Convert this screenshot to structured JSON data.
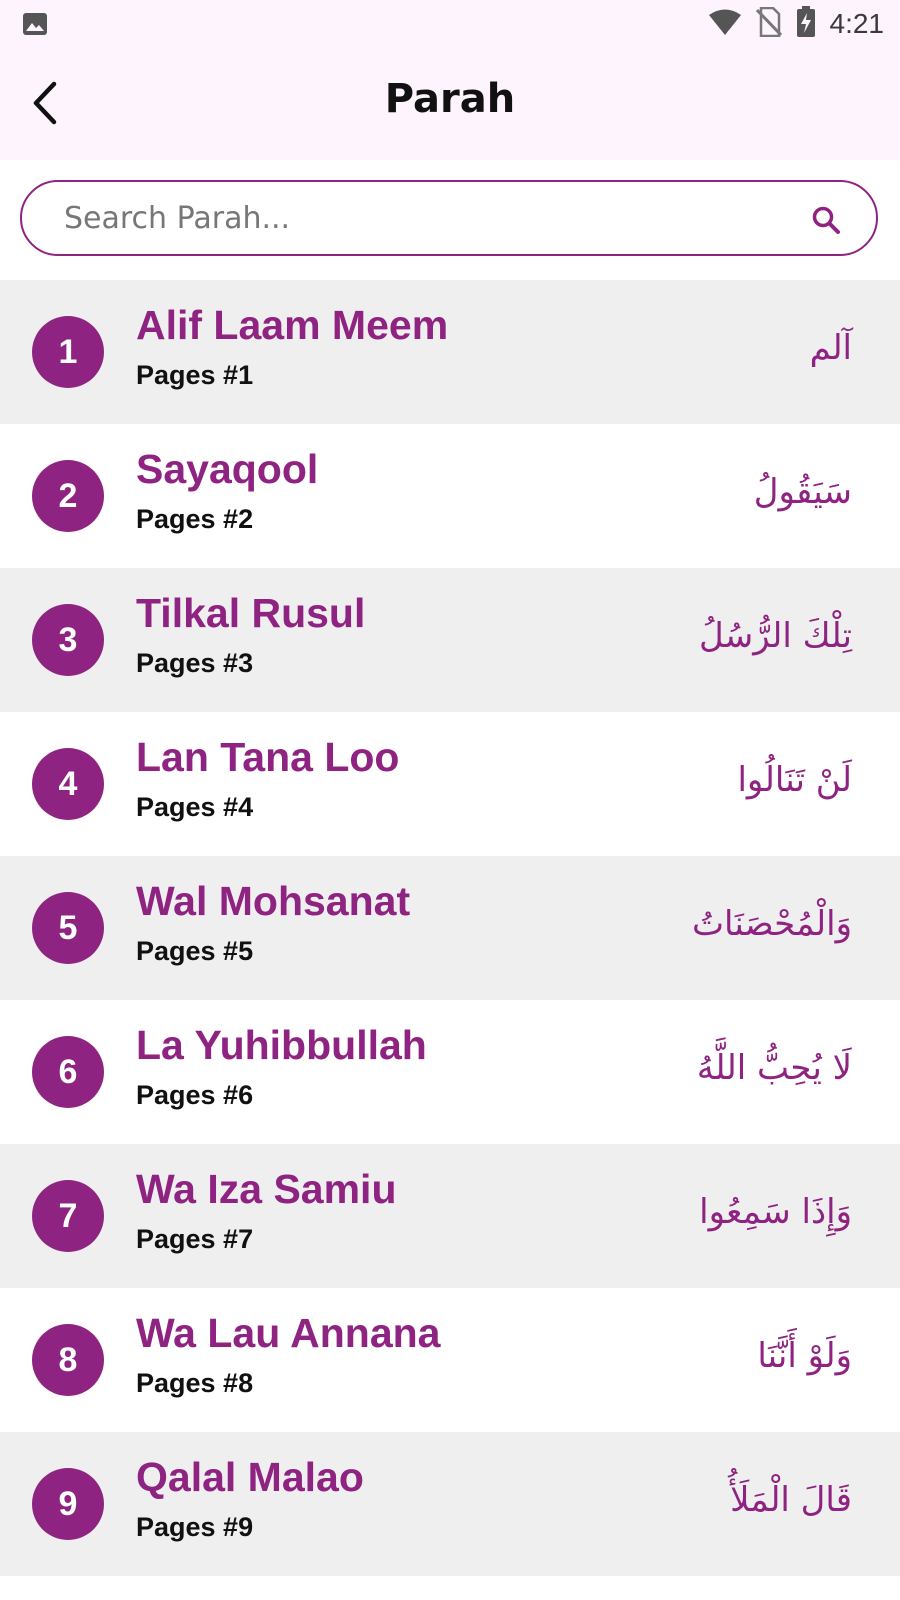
{
  "status_bar": {
    "time": "4:21",
    "left_icon": "image-icon",
    "right_icons": [
      "wifi-icon",
      "no-sim-icon",
      "battery-charging-icon"
    ]
  },
  "app_bar": {
    "title": "Parah",
    "back_icon": "back-arrow-icon"
  },
  "search": {
    "placeholder": "Search Parah...",
    "value": "",
    "icon": "search-icon"
  },
  "colors": {
    "accent": "#8f2381",
    "header_bg": "#fdf4fd",
    "row_shade": "#efefef"
  },
  "parahs": [
    {
      "number": "1",
      "name": "Alif Laam Meem",
      "pages": "Pages #1",
      "arabic": "آلم"
    },
    {
      "number": "2",
      "name": "Sayaqool",
      "pages": "Pages #2",
      "arabic": "سَيَقُولُ"
    },
    {
      "number": "3",
      "name": "Tilkal Rusul",
      "pages": "Pages #3",
      "arabic": "تِلْكَ الرُّسُلُ"
    },
    {
      "number": "4",
      "name": "Lan Tana Loo",
      "pages": "Pages #4",
      "arabic": "لَنْ تَنَالُوا"
    },
    {
      "number": "5",
      "name": "Wal Mohsanat",
      "pages": "Pages #5",
      "arabic": "وَالْمُحْصَنَاتُ"
    },
    {
      "number": "6",
      "name": "La Yuhibbullah",
      "pages": "Pages #6",
      "arabic": "لَا يُحِبُّ اللَّهُ"
    },
    {
      "number": "7",
      "name": "Wa Iza Samiu",
      "pages": "Pages #7",
      "arabic": "وَإِذَا سَمِعُوا"
    },
    {
      "number": "8",
      "name": "Wa Lau Annana",
      "pages": "Pages #8",
      "arabic": "وَلَوْ أَنَّنَا"
    },
    {
      "number": "9",
      "name": "Qalal Malao",
      "pages": "Pages #9",
      "arabic": "قَالَ الْمَلَأُ"
    }
  ]
}
